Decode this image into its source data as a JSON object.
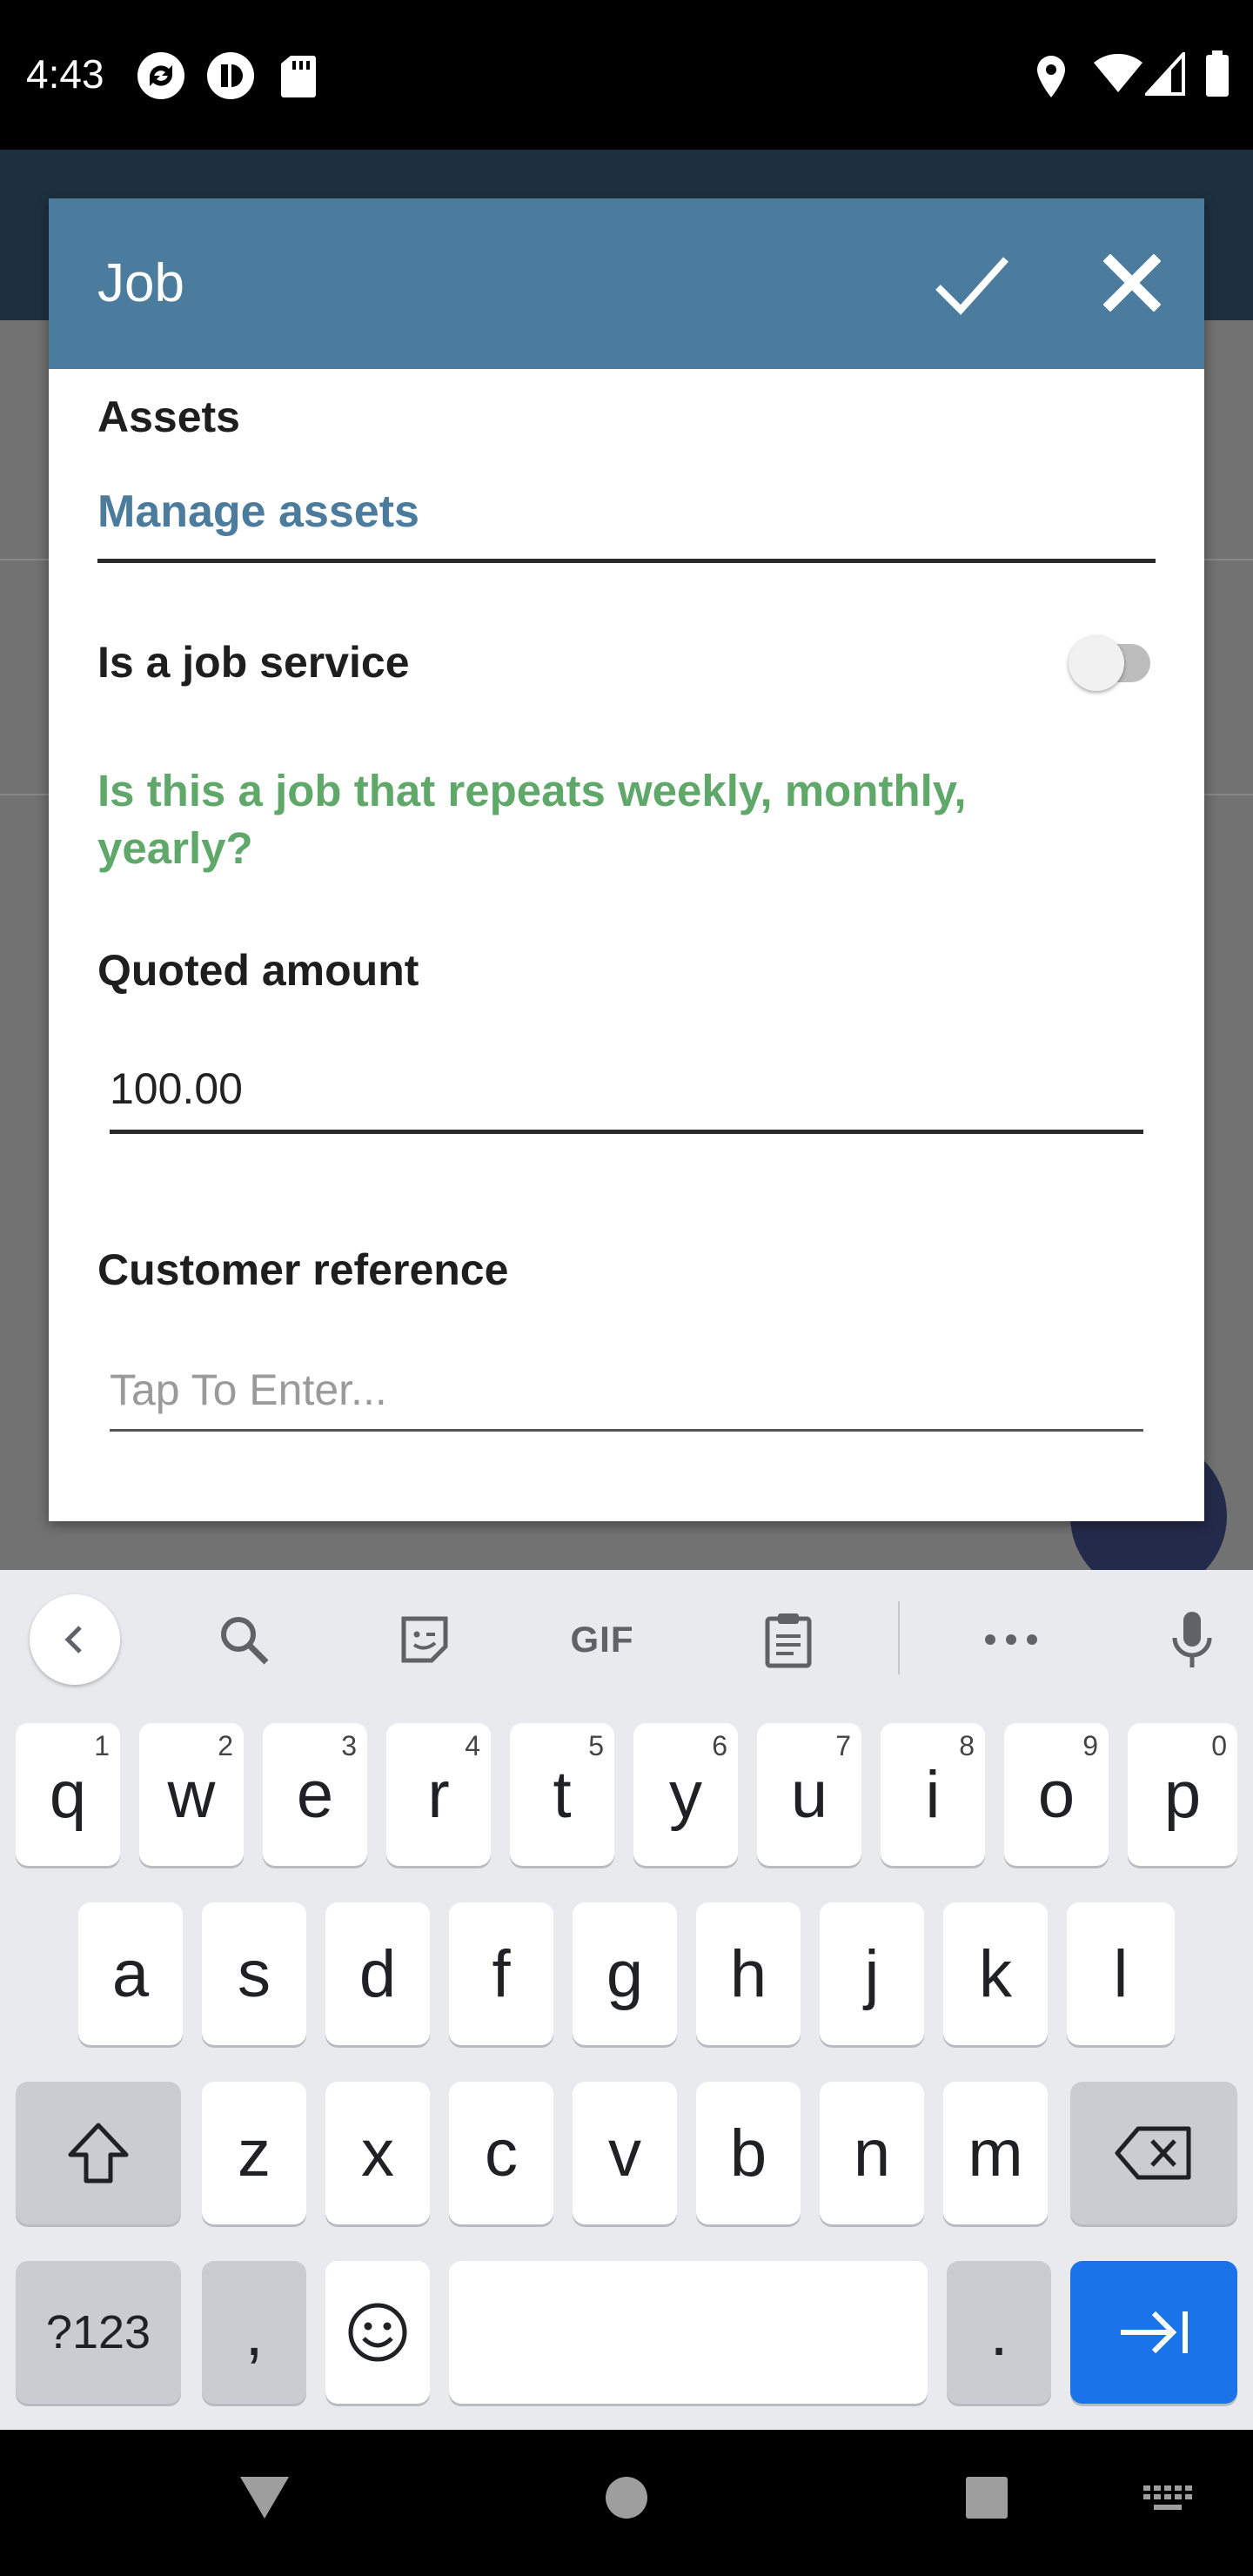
{
  "status_bar": {
    "time": "4:43",
    "left_icons": [
      "sync-icon",
      "data-saver-icon",
      "sd-card-icon"
    ],
    "right_icons": [
      "location-icon",
      "wifi-icon",
      "signal-icon",
      "battery-icon"
    ]
  },
  "dialog": {
    "title": "Job",
    "confirm_icon": "check-icon",
    "close_icon": "close-icon",
    "assets_label": "Assets",
    "manage_assets_link": "Manage assets",
    "job_service_label": "Is a job service",
    "job_service_enabled": false,
    "repeat_hint": "Is this a job that repeats weekly, monthly, yearly?",
    "quoted_amount_label": "Quoted amount",
    "quoted_amount_value": "100.00",
    "customer_reference_label": "Customer reference",
    "customer_reference_placeholder": "Tap To Enter..."
  },
  "keyboard": {
    "toolbar": {
      "items": [
        "back-chevron-icon",
        "search-icon",
        "sticker-icon",
        "GIF",
        "clipboard-icon",
        "more-icon",
        "microphone-icon"
      ],
      "gif_label": "GIF"
    },
    "row1": [
      {
        "key": "q",
        "sup": "1"
      },
      {
        "key": "w",
        "sup": "2"
      },
      {
        "key": "e",
        "sup": "3"
      },
      {
        "key": "r",
        "sup": "4"
      },
      {
        "key": "t",
        "sup": "5"
      },
      {
        "key": "y",
        "sup": "6"
      },
      {
        "key": "u",
        "sup": "7"
      },
      {
        "key": "i",
        "sup": "8"
      },
      {
        "key": "o",
        "sup": "9"
      },
      {
        "key": "p",
        "sup": "0"
      }
    ],
    "row2": [
      "a",
      "s",
      "d",
      "f",
      "g",
      "h",
      "j",
      "k",
      "l"
    ],
    "row3": [
      "z",
      "x",
      "c",
      "v",
      "b",
      "n",
      "m"
    ],
    "bottom": {
      "symbols_label": "?123",
      "comma_label": ",",
      "period_label": "."
    },
    "colors": {
      "accent": "#1a73e8"
    }
  },
  "nav_bar": {
    "buttons": [
      "back-triangle-icon",
      "home-circle-icon",
      "recents-square-icon",
      "keyboard-switch-icon"
    ]
  },
  "colors": {
    "header": "#4b7b9d",
    "hint_green": "#5fa86a",
    "link": "#4b7b9d"
  }
}
